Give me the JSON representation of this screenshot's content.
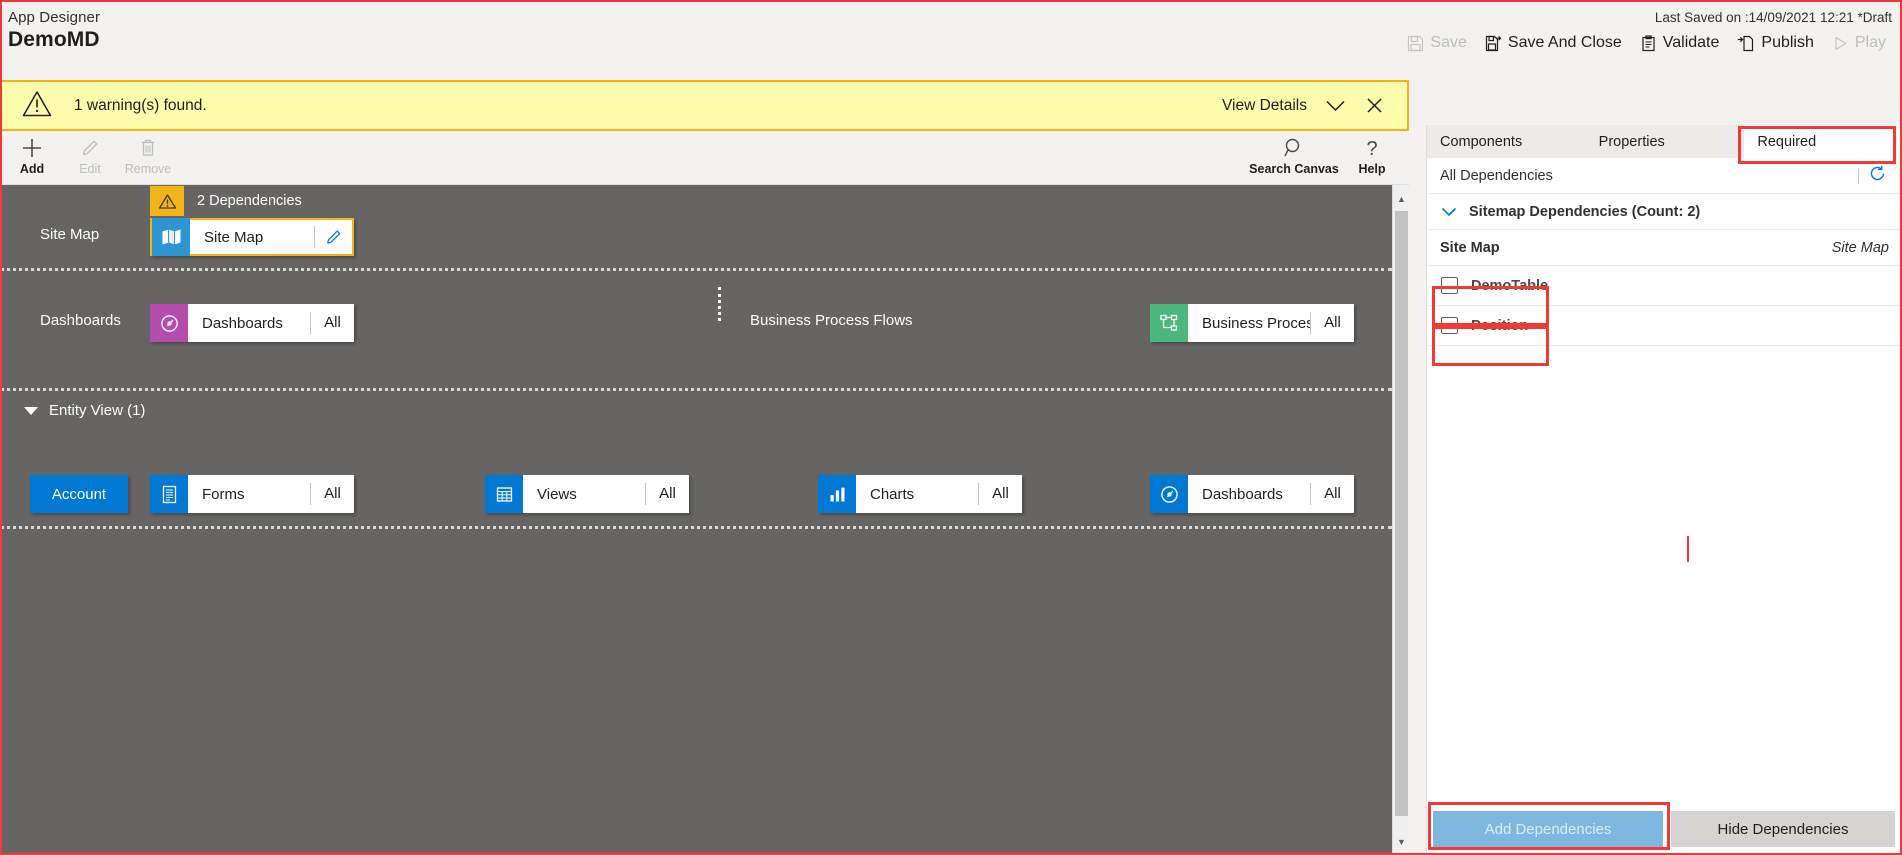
{
  "header": {
    "app_designer_label": "App Designer",
    "app_title": "DemoMD",
    "last_saved": "Last Saved on :14/09/2021 12:21 *Draft",
    "commands": [
      {
        "label": "Save",
        "icon": "save-icon",
        "disabled": true
      },
      {
        "label": "Save And Close",
        "icon": "save-and-close-icon",
        "disabled": false
      },
      {
        "label": "Validate",
        "icon": "validate-icon",
        "disabled": false
      },
      {
        "label": "Publish",
        "icon": "publish-icon",
        "disabled": false
      },
      {
        "label": "Play",
        "icon": "play-icon",
        "disabled": true
      }
    ]
  },
  "warning": {
    "icon": "warning-triangle-icon",
    "text": "1 warning(s) found.",
    "view_details": "View Details",
    "chevron_icon": "chevron-down-icon",
    "close_icon": "close-icon",
    "background": "#fdfbac",
    "border": "#f2b417"
  },
  "canvas_commands": [
    {
      "label": "Add",
      "icon": "plus-icon",
      "disabled": false
    },
    {
      "label": "Edit",
      "icon": "pencil-icon",
      "disabled": true
    },
    {
      "label": "Remove",
      "icon": "trash-icon",
      "disabled": true
    },
    {
      "label": "Search Canvas",
      "icon": "search-icon",
      "disabled": false
    },
    {
      "label": "Help",
      "icon": "question-icon",
      "disabled": false
    }
  ],
  "canvas": {
    "background": "#666564",
    "sitemap_row": {
      "section_label": "Site Map",
      "dependency_badge": {
        "icon": "warning-triangle-icon",
        "text": "2 Dependencies",
        "icon_background": "#f2b417"
      },
      "tile": {
        "name": "Site Map",
        "icon": "map-icon",
        "icon_background": "#2e95d3",
        "edit_icon": "pencil-icon",
        "highlighted": true
      }
    },
    "dashboards_row": {
      "section_label": "Dashboards",
      "tile": {
        "name": "Dashboards",
        "icon": "dashboard-gauge-icon",
        "icon_background": "#b44dae",
        "all": "All"
      }
    },
    "bpf_row": {
      "section_label": "Business Process Flows",
      "tile": {
        "name": "Business Proces...",
        "icon": "process-flow-icon",
        "icon_background": "#4cb77a",
        "all": "All"
      }
    },
    "entity_view": {
      "header": "Entity View (1)",
      "caret_icon": "caret-down-icon",
      "entity_button": "Account",
      "tiles": [
        {
          "name": "Forms",
          "icon": "forms-icon",
          "icon_background": "#0078d4",
          "all": "All"
        },
        {
          "name": "Views",
          "icon": "views-grid-icon",
          "icon_background": "#0078d4",
          "all": "All"
        },
        {
          "name": "Charts",
          "icon": "charts-bar-icon",
          "icon_background": "#0078d4",
          "all": "All"
        },
        {
          "name": "Dashboards",
          "icon": "dashboard-gauge-icon",
          "icon_background": "#0078d4",
          "all": "All"
        }
      ]
    }
  },
  "right_panel": {
    "tabs": [
      {
        "label": "Components",
        "active": false
      },
      {
        "label": "Properties",
        "active": false
      },
      {
        "label": "Required",
        "active": true
      }
    ],
    "all_dependencies_label": "All Dependencies",
    "refresh_icon": "refresh-icon",
    "group": {
      "caret_icon": "chevron-down-icon",
      "label": "Sitemap Dependencies (Count: 2)"
    },
    "list_header": {
      "left": "Site Map",
      "right": "Site Map"
    },
    "items": [
      {
        "label": "DemoTable",
        "checked": false
      },
      {
        "label": "Position",
        "checked": false
      }
    ],
    "footer": {
      "add_label": "Add Dependencies",
      "add_disabled": true,
      "hide_label": "Hide Dependencies"
    }
  },
  "annotations": {
    "color": "#f03a36",
    "boxes": [
      "required-tab",
      "demotable-row",
      "position-row",
      "add-dependencies-button",
      "page-outline"
    ]
  }
}
